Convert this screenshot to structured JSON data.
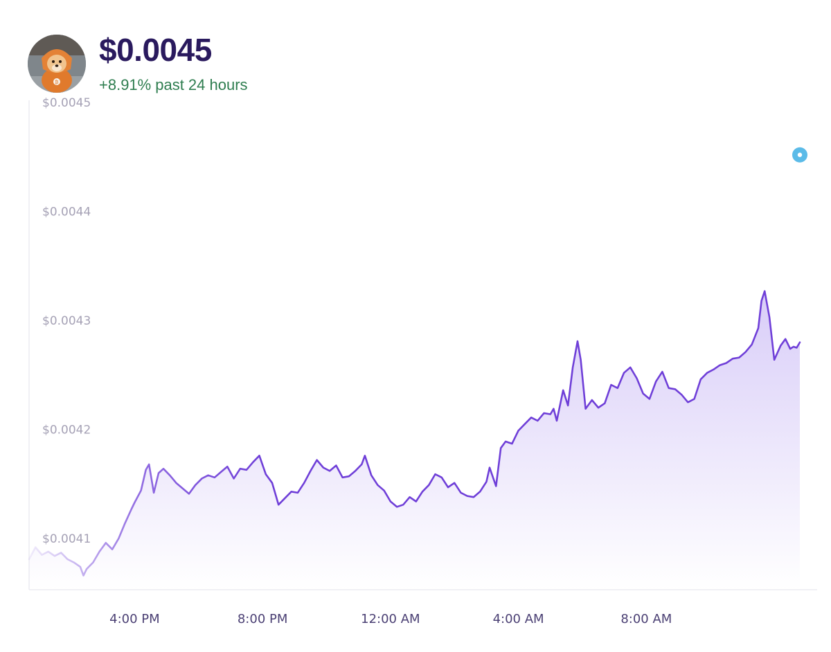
{
  "header": {
    "price": "$0.0045",
    "change_value": "+8.91%",
    "change_period": "past 24 hours"
  },
  "avatar": {
    "name": "dog-in-orange-hoodie-avatar"
  },
  "colors": {
    "line": "#6f3fd8",
    "fill": "#b9a4f2",
    "current_line": "#5bbbe8",
    "marker": "#5bbbe8",
    "price_text": "#2a1a5e",
    "change_text": "#2e7d4f"
  },
  "chart_data": {
    "type": "area",
    "title": "",
    "xlabel": "",
    "ylabel": "",
    "y_ticks": [
      "$0.0045",
      "$0.0044",
      "$0.0043",
      "$0.0042",
      "$0.0041"
    ],
    "y_tick_values": [
      0.0045,
      0.0044,
      0.0043,
      0.0042,
      0.0041
    ],
    "x_ticks": [
      "4:00 PM",
      "8:00 PM",
      "12:00 AM",
      "4:00 AM",
      "8:00 AM"
    ],
    "x_tick_hours": [
      16,
      20,
      24,
      28,
      32
    ],
    "ylim": [
      0.004053,
      0.004502
    ],
    "xlim_hours": [
      12.7,
      36.8
    ],
    "current_value": 0.004452,
    "grid": false,
    "series": [
      {
        "values": [
          [
            12.7,
            0.004081
          ],
          [
            12.9,
            0.004092
          ],
          [
            13.1,
            0.004085
          ],
          [
            13.3,
            0.004088
          ],
          [
            13.5,
            0.004084
          ],
          [
            13.7,
            0.004087
          ],
          [
            13.9,
            0.004081
          ],
          [
            14.1,
            0.004078
          ],
          [
            14.3,
            0.004074
          ],
          [
            14.4,
            0.004066
          ],
          [
            14.5,
            0.004072
          ],
          [
            14.7,
            0.004078
          ],
          [
            14.9,
            0.004088
          ],
          [
            15.1,
            0.004096
          ],
          [
            15.3,
            0.00409
          ],
          [
            15.5,
            0.0041
          ],
          [
            15.7,
            0.004114
          ],
          [
            15.9,
            0.004127
          ],
          [
            16.0,
            0.004133
          ],
          [
            16.2,
            0.004144
          ],
          [
            16.35,
            0.004163
          ],
          [
            16.45,
            0.004168
          ],
          [
            16.6,
            0.004142
          ],
          [
            16.75,
            0.00416
          ],
          [
            16.9,
            0.004164
          ],
          [
            17.1,
            0.004158
          ],
          [
            17.3,
            0.004151
          ],
          [
            17.5,
            0.004146
          ],
          [
            17.7,
            0.004141
          ],
          [
            17.9,
            0.004149
          ],
          [
            18.1,
            0.004155
          ],
          [
            18.3,
            0.004158
          ],
          [
            18.5,
            0.004156
          ],
          [
            18.7,
            0.004161
          ],
          [
            18.9,
            0.004166
          ],
          [
            19.1,
            0.004155
          ],
          [
            19.3,
            0.004164
          ],
          [
            19.5,
            0.004163
          ],
          [
            19.7,
            0.00417
          ],
          [
            19.9,
            0.004176
          ],
          [
            20.1,
            0.004159
          ],
          [
            20.3,
            0.004151
          ],
          [
            20.4,
            0.004141
          ],
          [
            20.5,
            0.004131
          ],
          [
            20.7,
            0.004137
          ],
          [
            20.9,
            0.004143
          ],
          [
            21.1,
            0.004142
          ],
          [
            21.3,
            0.004151
          ],
          [
            21.5,
            0.004162
          ],
          [
            21.7,
            0.004172
          ],
          [
            21.9,
            0.004165
          ],
          [
            22.1,
            0.004162
          ],
          [
            22.3,
            0.004167
          ],
          [
            22.5,
            0.004156
          ],
          [
            22.7,
            0.004157
          ],
          [
            22.9,
            0.004162
          ],
          [
            23.1,
            0.004168
          ],
          [
            23.2,
            0.004176
          ],
          [
            23.4,
            0.004158
          ],
          [
            23.6,
            0.004149
          ],
          [
            23.8,
            0.004144
          ],
          [
            24.0,
            0.004134
          ],
          [
            24.2,
            0.004129
          ],
          [
            24.4,
            0.004131
          ],
          [
            24.6,
            0.004138
          ],
          [
            24.8,
            0.004134
          ],
          [
            25.0,
            0.004143
          ],
          [
            25.2,
            0.004149
          ],
          [
            25.4,
            0.004159
          ],
          [
            25.6,
            0.004156
          ],
          [
            25.8,
            0.004147
          ],
          [
            26.0,
            0.004151
          ],
          [
            26.2,
            0.004142
          ],
          [
            26.4,
            0.004139
          ],
          [
            26.6,
            0.004138
          ],
          [
            26.8,
            0.004143
          ],
          [
            27.0,
            0.004152
          ],
          [
            27.1,
            0.004165
          ],
          [
            27.3,
            0.004148
          ],
          [
            27.45,
            0.004183
          ],
          [
            27.6,
            0.004189
          ],
          [
            27.8,
            0.004187
          ],
          [
            28.0,
            0.004199
          ],
          [
            28.2,
            0.004205
          ],
          [
            28.4,
            0.004211
          ],
          [
            28.6,
            0.004208
          ],
          [
            28.8,
            0.004215
          ],
          [
            29.0,
            0.004214
          ],
          [
            29.1,
            0.004219
          ],
          [
            29.2,
            0.004208
          ],
          [
            29.4,
            0.004236
          ],
          [
            29.55,
            0.004222
          ],
          [
            29.7,
            0.004257
          ],
          [
            29.85,
            0.004281
          ],
          [
            29.95,
            0.004264
          ],
          [
            30.1,
            0.004219
          ],
          [
            30.3,
            0.004227
          ],
          [
            30.5,
            0.00422
          ],
          [
            30.7,
            0.004224
          ],
          [
            30.9,
            0.004241
          ],
          [
            31.1,
            0.004238
          ],
          [
            31.3,
            0.004252
          ],
          [
            31.5,
            0.004257
          ],
          [
            31.7,
            0.004247
          ],
          [
            31.9,
            0.004233
          ],
          [
            32.1,
            0.004228
          ],
          [
            32.3,
            0.004244
          ],
          [
            32.5,
            0.004253
          ],
          [
            32.7,
            0.004238
          ],
          [
            32.9,
            0.004237
          ],
          [
            33.1,
            0.004232
          ],
          [
            33.3,
            0.004225
          ],
          [
            33.5,
            0.004228
          ],
          [
            33.7,
            0.004246
          ],
          [
            33.9,
            0.004252
          ],
          [
            34.1,
            0.004255
          ],
          [
            34.3,
            0.004259
          ],
          [
            34.5,
            0.004261
          ],
          [
            34.7,
            0.004265
          ],
          [
            34.9,
            0.004266
          ],
          [
            35.1,
            0.004271
          ],
          [
            35.3,
            0.004278
          ],
          [
            35.5,
            0.004293
          ],
          [
            35.6,
            0.004318
          ],
          [
            35.7,
            0.004327
          ],
          [
            35.85,
            0.004303
          ],
          [
            36.0,
            0.004264
          ],
          [
            36.2,
            0.004277
          ],
          [
            36.35,
            0.004283
          ],
          [
            36.5,
            0.004274
          ],
          [
            36.6,
            0.004276
          ],
          [
            36.7,
            0.004275
          ],
          [
            36.8,
            0.00428
          ]
        ]
      }
    ]
  }
}
